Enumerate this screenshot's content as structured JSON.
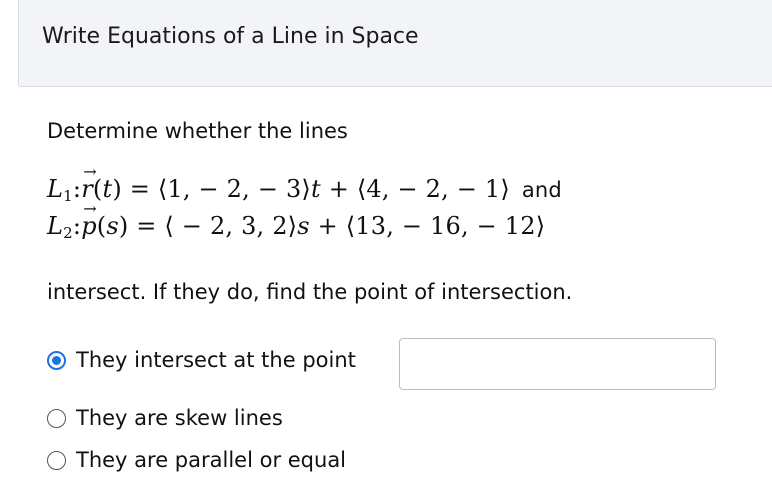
{
  "header": {
    "title": "Write Equations of a Line in Space"
  },
  "question": {
    "intro": "Determine whether the lines",
    "line1": {
      "name": "L",
      "subscript": "1",
      "func": "r",
      "param": "t",
      "eq_text": " = ⟨1, − 2, − 3⟩",
      "tail_text": " + ⟨4, − 2, − 1⟩",
      "joiner": "and"
    },
    "line2": {
      "name": "L",
      "subscript": "2",
      "func": "p",
      "param": "s",
      "eq_text": " = ⟨ − 2, 3, 2⟩",
      "tail_text": " + ⟨13, − 16, − 12⟩"
    },
    "outro": "intersect. If they do, find the point of intersection."
  },
  "options": [
    {
      "label": "They intersect at the point",
      "selected": true
    },
    {
      "label": "They are skew lines",
      "selected": false
    },
    {
      "label": "They are parallel or equal",
      "selected": false
    }
  ],
  "answer": {
    "value": "",
    "placeholder": ""
  },
  "colors": {
    "accent": "#1a73e8",
    "header_bg": "#f2f4f8",
    "border": "#d8dbe2"
  }
}
